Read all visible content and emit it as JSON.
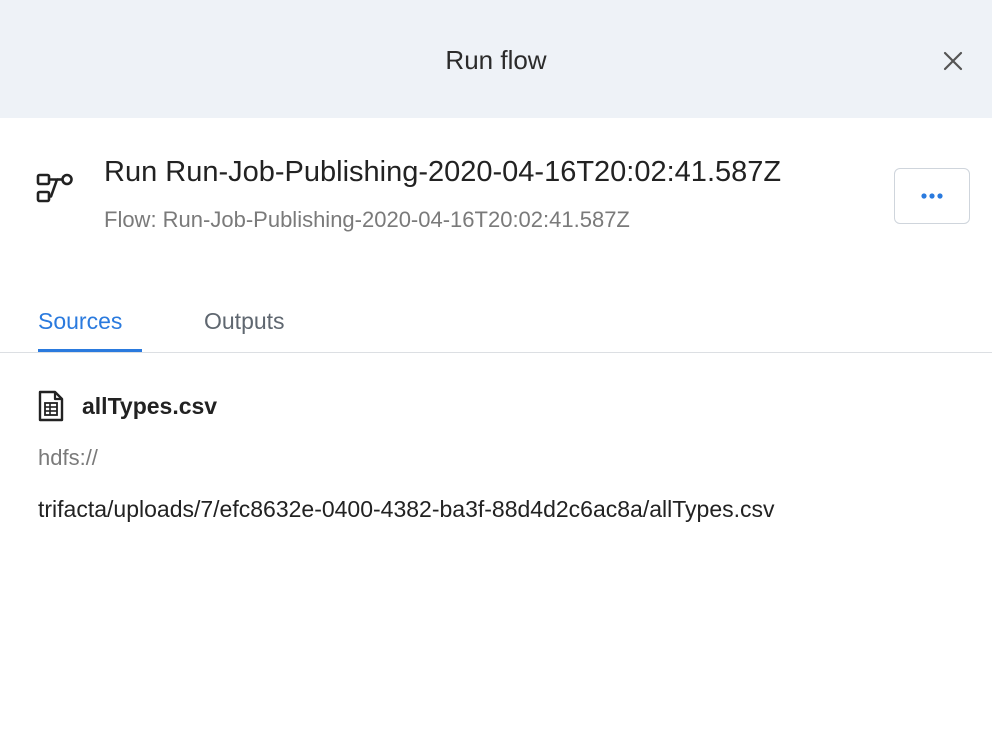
{
  "dialog": {
    "title": "Run flow",
    "close_icon": "close-icon"
  },
  "flow": {
    "icon": "flow-icon",
    "title": "Run Run-Job-Publishing-2020-04-16T20:02:41.587Z",
    "subtitle": "Flow: Run-Job-Publishing-2020-04-16T20:02:41.587Z",
    "more_icon": "more-options-icon"
  },
  "tabs": [
    {
      "label": "Sources",
      "active": true
    },
    {
      "label": "Outputs",
      "active": false
    }
  ],
  "sources": [
    {
      "icon": "file-icon",
      "name": "allTypes.csv",
      "protocol": "hdfs://",
      "path": "trifacta/uploads/7/efc8632e-0400-4382-ba3f-88d4d2c6ac8a/allTypes.csv"
    }
  ],
  "colors": {
    "header_bg": "#eef2f7",
    "accent": "#2a7ade",
    "muted_text": "#7a7a7a"
  }
}
